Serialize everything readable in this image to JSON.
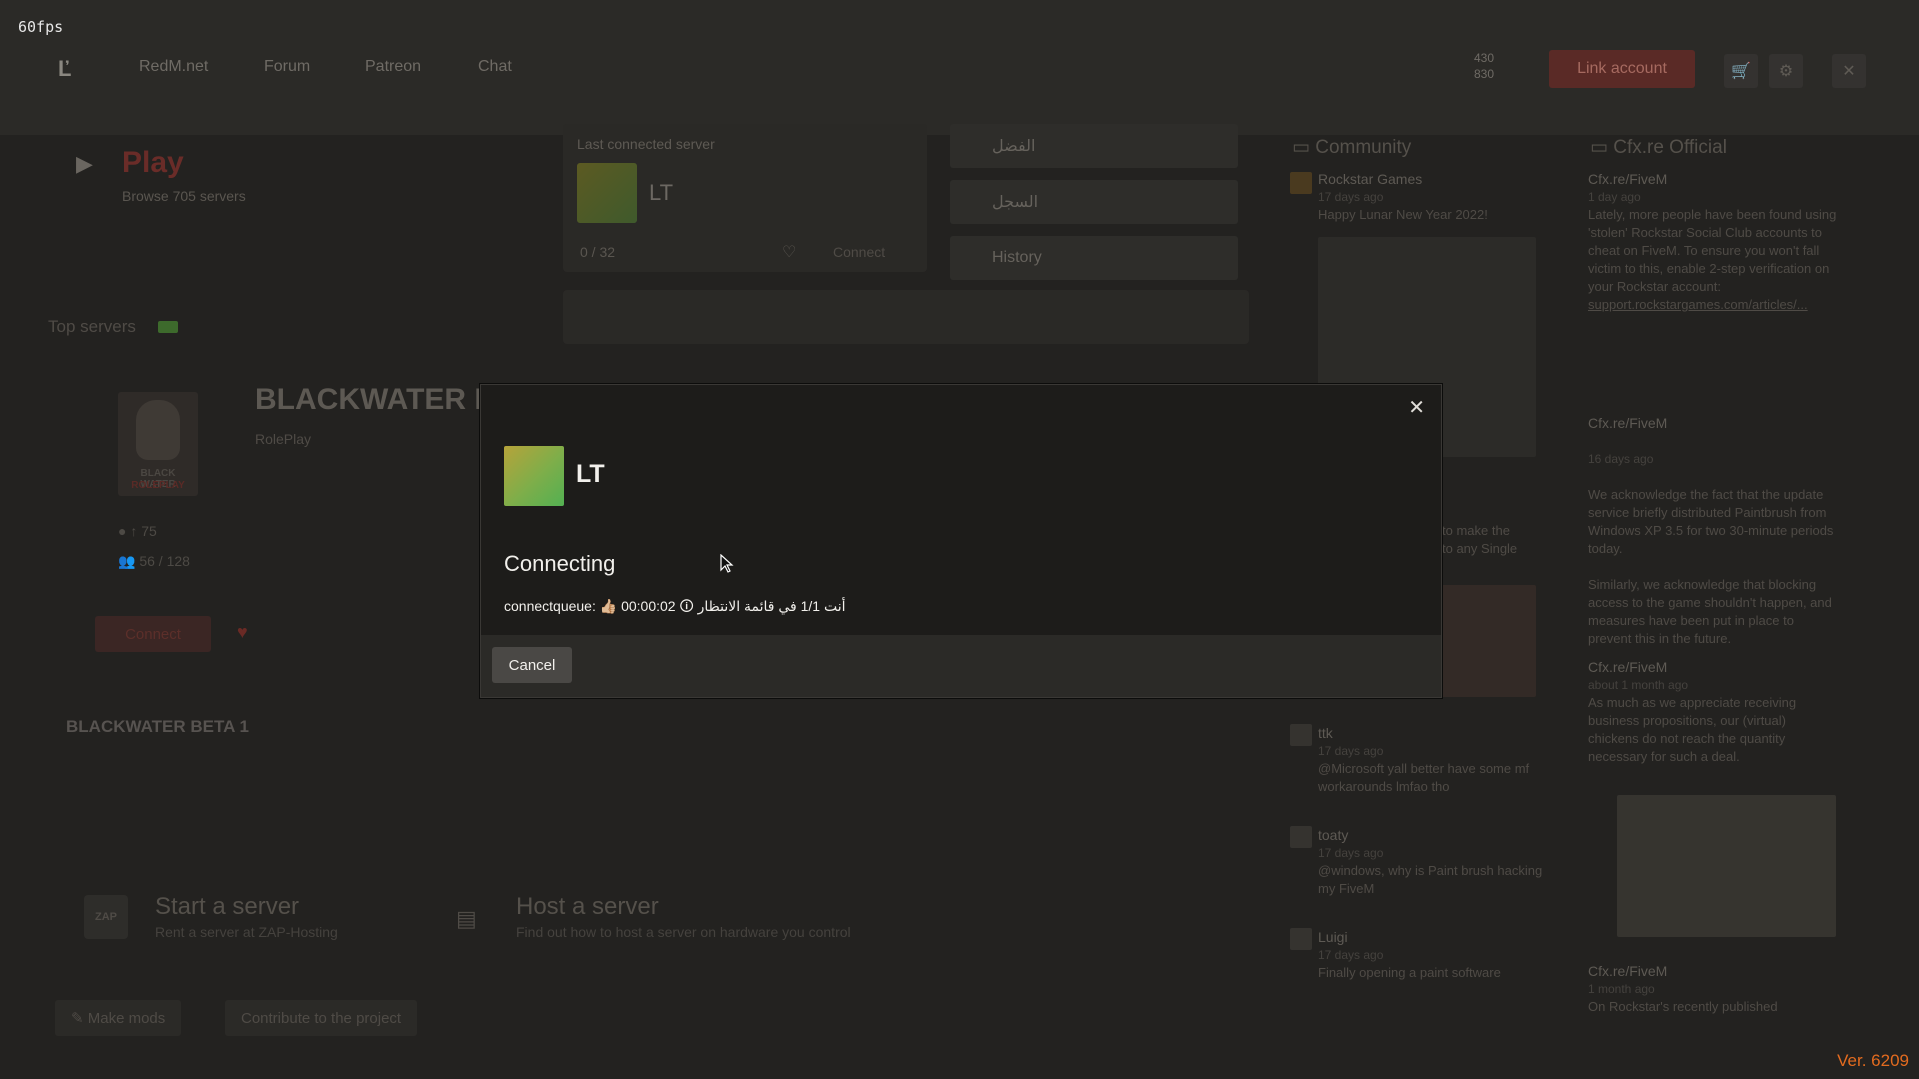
{
  "overlay_info": {
    "fps": "60fps",
    "version": "Ver. 6209"
  },
  "nav": {
    "items": [
      "RedM.net",
      "Forum",
      "Patreon",
      "Chat"
    ],
    "players": [
      "430",
      "830"
    ],
    "link_account": "Link account"
  },
  "play": {
    "title": "Play",
    "subtitle": "Browse 705 servers"
  },
  "last_connected": {
    "label": "Last connected server",
    "name": "LT",
    "players": "0 / 32",
    "connect": "Connect"
  },
  "side_menu": [
    "الفضل",
    "السجل",
    "History"
  ],
  "top_servers": {
    "label": "Top servers",
    "server": {
      "logo_line1": "BLACK WATER",
      "logo_line2": "ROLEPLAY",
      "name": "BLACKWATER BE",
      "category": "RolePlay",
      "upvotes": "75",
      "players": "56 / 128",
      "connect": "Connect",
      "list_name": "BLACKWATER BETA 1"
    }
  },
  "footer_cards": {
    "start": {
      "title": "Start a server",
      "subtitle": "Rent a server at ZAP-Hosting",
      "icon_text": "ZAP"
    },
    "host": {
      "title": "Host a server",
      "subtitle": "Find out how to host a server on hardware you control"
    },
    "make_mods": "Make mods",
    "contribute": "Contribute to the project"
  },
  "community": {
    "title": "Community",
    "posts": [
      {
        "author": "Rockstar Games",
        "time": "17 days ago",
        "text": "Happy Lunar New Year 2022!"
      },
      {
        "author": "ttk",
        "time": "17 days ago",
        "text": "@Microsoft yall better have some mf workarounds lmfao tho"
      },
      {
        "author": "toaty",
        "time": "17 days ago",
        "text": "@windows, why is Paint brush hacking my FiveM"
      },
      {
        "author": "Luigi",
        "time": "17 days ago",
        "text": "Finally opening a paint software"
      }
    ],
    "side_text": "to make the\nto any Single"
  },
  "cfx": {
    "title": "Cfx.re Official",
    "posts": [
      {
        "author": "Cfx.re/FiveM",
        "time": "1 day ago",
        "text": "Lately, more people have been found using 'stolen' Rockstar Social Club accounts to cheat on FiveM. To ensure you won't fall victim to this, enable 2-step verification on your Rockstar account:",
        "link": "support.rockstargames.com/articles/..."
      },
      {
        "author": "Cfx.re/FiveM",
        "time": "16 days ago",
        "text": "We acknowledge the fact that the update service briefly distributed Paintbrush from Windows XP 3.5 for two 30-minute periods today.\n\nSimilarly, we acknowledge that blocking access to the game shouldn't happen, and measures have been put in place to prevent this in the future."
      },
      {
        "author": "Cfx.re/FiveM",
        "time": "about 1 month ago",
        "text": "As much as we appreciate receiving business propositions, our (virtual) chickens do not reach the quantity necessary for such a deal."
      },
      {
        "author": "Cfx.re/FiveM",
        "time": "1 month ago",
        "text": "On Rockstar's recently published"
      }
    ]
  },
  "modal": {
    "server_name": "LT",
    "status": "Connecting",
    "message": "connectqueue: 👍🏼 00:00:02 🛈 أنت 1/1 في قائمة الانتظار",
    "cancel": "Cancel",
    "close_icon": "close-icon"
  }
}
